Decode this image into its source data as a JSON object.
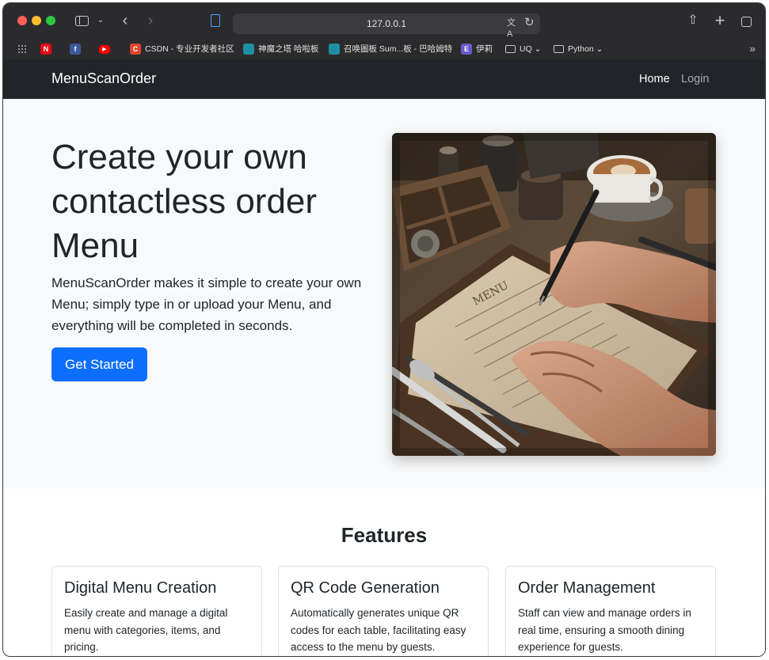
{
  "browser": {
    "url": "127.0.0.1",
    "bookmarks": [
      {
        "label": "",
        "icon": "netflix-icon"
      },
      {
        "label": "",
        "icon": "facebook-icon"
      },
      {
        "label": "",
        "icon": "youtube-icon"
      },
      {
        "label": "CSDN - 专业开发者社区",
        "icon": "csdn-icon"
      },
      {
        "label": "神魔之塔 哈啦板",
        "icon": "bahamut-icon"
      },
      {
        "label": "召唤圖板 Sum...板 - 巴哈姆特",
        "icon": "bahamut-icon"
      },
      {
        "label": "伊莉",
        "icon": "eyny-icon"
      },
      {
        "label": "UQ",
        "icon": "folder-icon"
      },
      {
        "label": "Python",
        "icon": "folder-icon"
      }
    ]
  },
  "navbar": {
    "brand": "MenuScanOrder",
    "links": [
      "Home",
      "Login"
    ]
  },
  "hero": {
    "title": "Create your own contactless order Menu",
    "lead": "MenuScanOrder makes it simple to create your own Menu; simply type in or upload your Menu, and everything will be completed in seconds.",
    "cta": "Get Started",
    "image_menu_text": "MENU"
  },
  "features": {
    "title": "Features",
    "cards": [
      {
        "title": "Digital Menu Creation",
        "text": "Easily create and manage a digital menu with categories, items, and pricing."
      },
      {
        "title": "QR Code Generation",
        "text": "Automatically generates unique QR codes for each table, facilitating easy access to the menu by guests."
      },
      {
        "title": "Order Management",
        "text": "Staff can view and manage orders in real time, ensuring a smooth dining experience for guests."
      }
    ]
  },
  "colors": {
    "primary": "#0d6efd",
    "navbar": "#212529",
    "hero_bg": "#f8f9fa"
  }
}
